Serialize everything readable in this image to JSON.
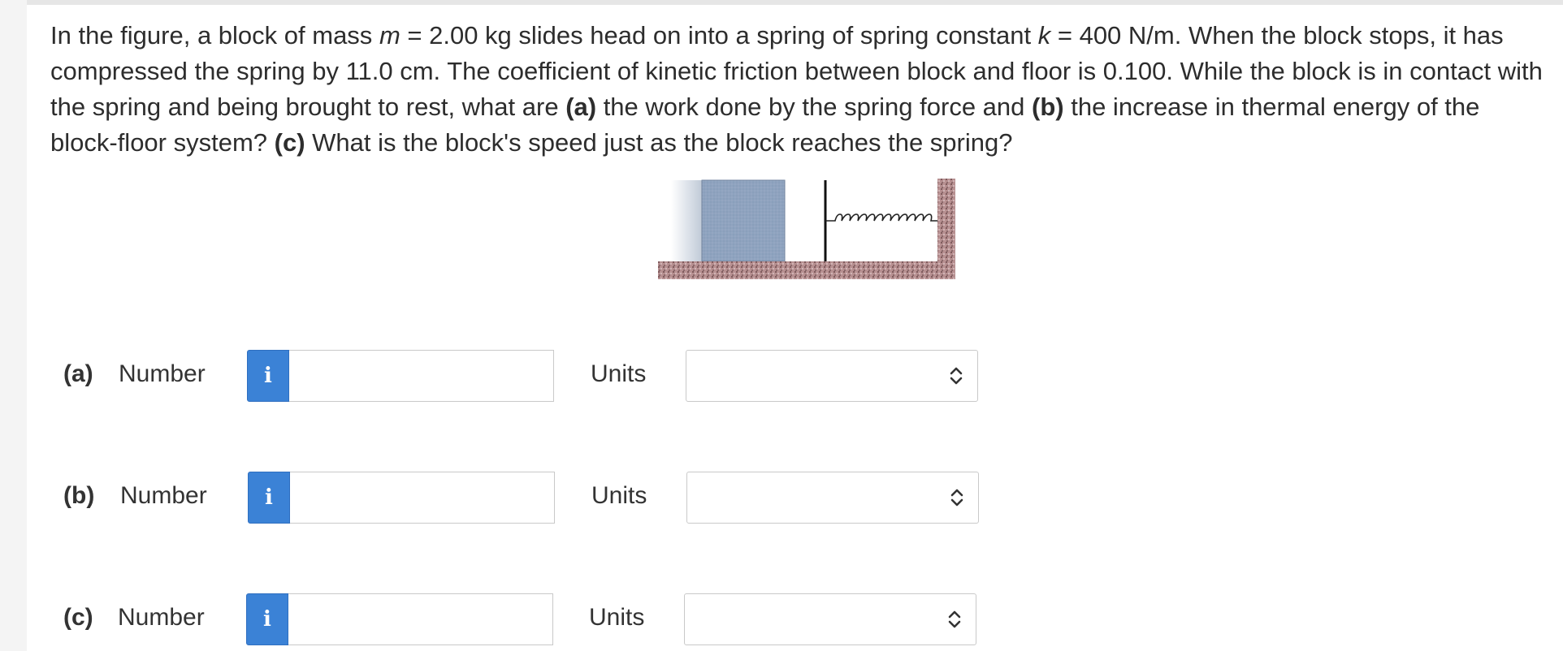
{
  "question": {
    "seg1": "In the figure, a block of mass ",
    "var_m": "m",
    "seg2": " = 2.00 kg slides head on into a spring of spring constant ",
    "var_k": "k",
    "seg3": " = 400 N/m. When the block stops, it has compressed the spring by 11.0 cm. The coefficient of kinetic friction between block and floor is 0.100. While the block is in contact with the spring and being brought to rest, what are ",
    "part_a": "(a)",
    "seg4": " the work done by the spring force and ",
    "part_b": "(b)",
    "seg5": " the increase in thermal energy of the block-floor system? ",
    "part_c": "(c)",
    "seg6": " What is the block's speed just as the block reaches the spring?"
  },
  "answers": [
    {
      "part": "(a)",
      "number_label": "Number",
      "info_icon": "i",
      "number_value": "",
      "units_label": "Units",
      "units_value": ""
    },
    {
      "part": "(b)",
      "number_label": "Number",
      "info_icon": "i",
      "number_value": "",
      "units_label": "Units",
      "units_value": ""
    },
    {
      "part": "(c)",
      "number_label": "Number",
      "info_icon": "i",
      "number_value": "",
      "units_label": "Units",
      "units_value": ""
    }
  ],
  "figure": {
    "block_color": "#8fa3bf",
    "floor_color": "#b5898b",
    "info_button_color": "#3b82d6"
  }
}
